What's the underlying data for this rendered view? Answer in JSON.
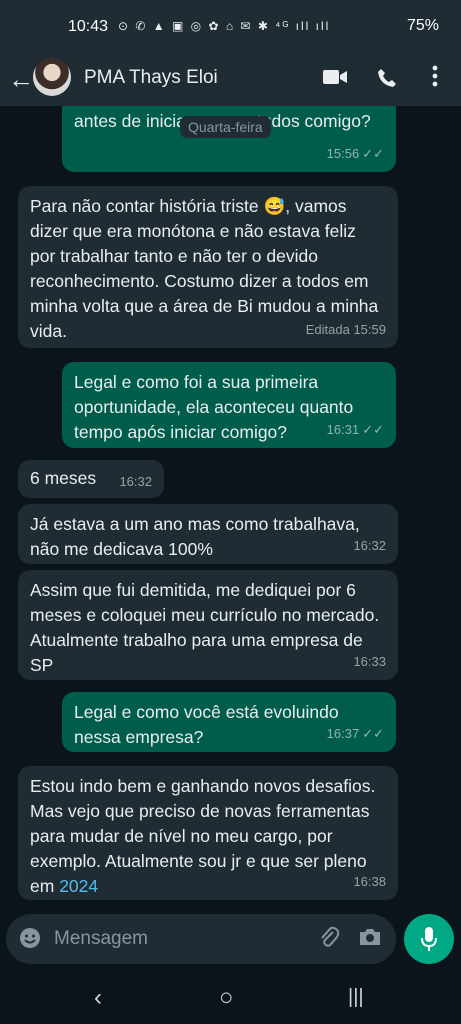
{
  "status_bar": {
    "time": "10:43",
    "icons_text": "⊙ ✆ ▲ ▣ ◎ ✿ ⌂ ✉ ✱ ⁴ᴳ ıll ıll",
    "battery": "75%"
  },
  "header": {
    "contact_name": "PMA Thays Eloi",
    "video_icon": "video-call-icon",
    "call_icon": "phone-icon",
    "menu_icon": "more-vert-icon"
  },
  "date_chip": "Quarta-feira",
  "messages": [
    {
      "dir": "out",
      "text": "Legal, e me diz como era a sua vida antes de iniciar seus estudos comigo?",
      "time": "15:56",
      "status": "✓✓",
      "edited": ""
    },
    {
      "dir": "in",
      "text_before": "Para não contar história triste ",
      "emoji": "😅",
      "text_after": ", vamos dizer que era monótona e não estava feliz por trabalhar tanto e não ter o devido reconhecimento. Costumo dizer a todos em minha volta que a área de Bi mudou a minha vida.",
      "time": "15:59",
      "edited": "Editada"
    },
    {
      "dir": "out",
      "text": "Legal e como foi a sua primeira oportunidade, ela aconteceu quanto tempo após iniciar comigo?",
      "time": "16:31",
      "status": "✓✓"
    },
    {
      "dir": "in",
      "text": "6 meses",
      "time": "16:32"
    },
    {
      "dir": "in",
      "text": "Já estava a um ano mas como trabalhava, não me dedicava 100%",
      "time": "16:32"
    },
    {
      "dir": "in",
      "text": "Assim que fui demitida, me dediquei por 6 meses e coloquei meu currículo no mercado. Atualmente trabalho para uma empresa de SP",
      "time": "16:33"
    },
    {
      "dir": "out",
      "text": "Legal e como você está evoluindo nessa empresa?",
      "time": "16:37",
      "status": "✓✓"
    },
    {
      "dir": "in",
      "text_before": "Estou indo bem e ganhando novos desafios. Mas vejo que preciso de novas ferramentas para mudar de nível no meu cargo, por exemplo. Atualmente sou jr e que ser pleno em ",
      "link": "2024",
      "time": "16:38"
    }
  ],
  "composer": {
    "placeholder": "Mensagem",
    "emoji_icon": "emoji-icon",
    "attach_icon": "paperclip-icon",
    "camera_icon": "camera-icon",
    "mic_icon": "microphone-icon"
  },
  "nav": {
    "back": "‹",
    "home": "○",
    "recents": "|||"
  },
  "colors": {
    "outgoing_bubble": "#005c4b",
    "incoming_bubble": "#1f2c34",
    "background": "#0b141a",
    "accent": "#00a884",
    "link": "#53bdeb"
  }
}
